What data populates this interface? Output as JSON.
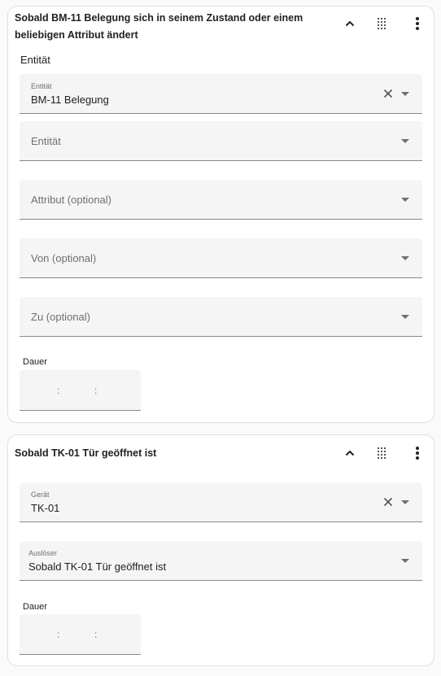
{
  "trigger1": {
    "title": "Sobald BM-11 Belegung sich in seinem Zustand oder einem beliebigen Attribut ändert",
    "section_label": "Entität",
    "entity_field": {
      "label": "Entität",
      "value": "BM-11 Belegung"
    },
    "entity_field_2": {
      "placeholder": "Entität"
    },
    "attribute_field": {
      "placeholder": "Attribut (optional)"
    },
    "from_field": {
      "placeholder": "Von (optional)"
    },
    "to_field": {
      "placeholder": "Zu (optional)"
    },
    "duration_label": "Dauer",
    "duration_colon": ":"
  },
  "trigger2": {
    "title": "Sobald TK-01 Tür geöffnet ist",
    "device_field": {
      "label": "Gerät",
      "value": "TK-01"
    },
    "trigger_field": {
      "label": "Auslöser",
      "value": "Sobald TK-01 Tür geöffnet ist"
    },
    "duration_label": "Dauer",
    "duration_colon": ":"
  },
  "icons": {
    "collapse": "chevron-up-icon",
    "drag": "drag-handle-icon",
    "menu": "more-vertical-icon",
    "clear": "close-icon",
    "dropdown": "arrow-drop-down-icon"
  },
  "colors": {
    "card_bg": "#ffffff",
    "field_bg": "#f5f5f5",
    "page_bg": "#fafafa",
    "text": "#212121",
    "muted": "#6f6f6f"
  }
}
